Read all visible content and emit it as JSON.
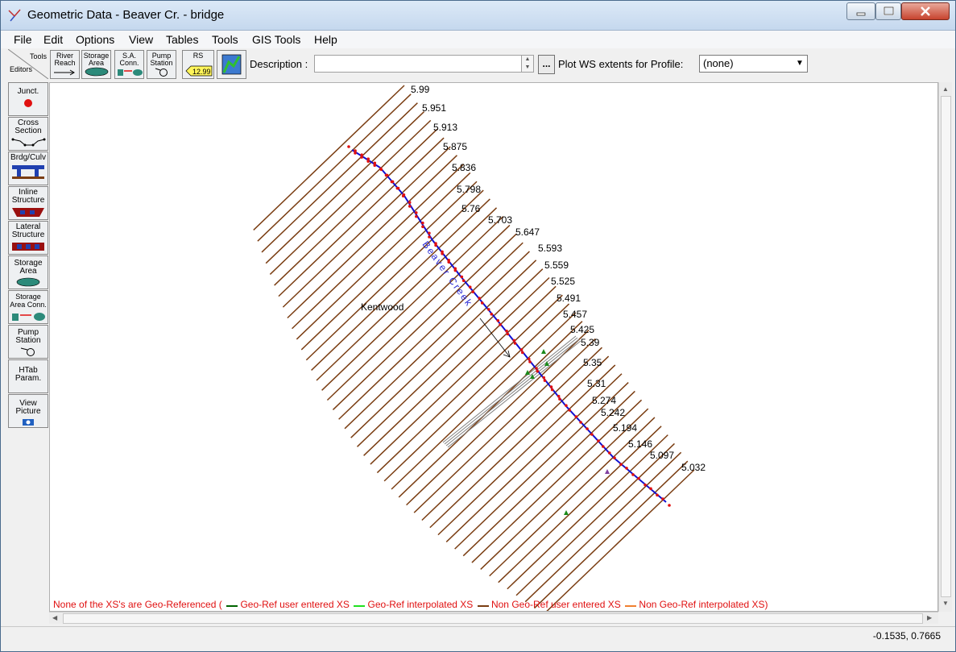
{
  "window": {
    "title": "Geometric Data - Beaver Cr.  - bridge",
    "icon": "hec-ras-geometry-icon"
  },
  "menu": [
    "File",
    "Edit",
    "Options",
    "View",
    "Tables",
    "Tools",
    "GIS Tools",
    "Help"
  ],
  "toolbar": {
    "tools_label": "Tools",
    "editors_label": "Editors",
    "buttons": [
      {
        "label": "River\nReach",
        "icon": "river-reach-icon"
      },
      {
        "label": "Storage\nArea",
        "icon": "storage-area-icon"
      },
      {
        "label": "S.A.\nConn.",
        "icon": "sa-connection-icon"
      },
      {
        "label": "Pump\nStation",
        "icon": "pump-station-icon"
      },
      {
        "label": "RS",
        "value": "12.99",
        "icon": "river-station-tag-icon"
      },
      {
        "label": "",
        "icon": "map-picture-icon"
      }
    ],
    "description_label": "Description :",
    "description_value": "",
    "more_button": "...",
    "plot_ws_label": "Plot WS extents for Profile:",
    "plot_ws_value": "(none)"
  },
  "sidebar": [
    {
      "label": "Junct.",
      "icon": "junction-dot-icon"
    },
    {
      "label": "Cross\nSection",
      "icon": "cross-section-icon"
    },
    {
      "label": "Brdg/Culv",
      "icon": "bridge-culvert-icon"
    },
    {
      "label": "Inline\nStructure",
      "icon": "inline-structure-icon"
    },
    {
      "label": "Lateral\nStructure",
      "icon": "lateral-structure-icon"
    },
    {
      "label": "Storage\nArea",
      "icon": "storage-area-icon"
    },
    {
      "label": "Storage\nArea Conn.",
      "icon": "storage-area-conn-icon"
    },
    {
      "label": "Pump\nStation",
      "icon": "pump-station-icon"
    },
    {
      "label": "HTab\nParam.",
      "icon": ""
    },
    {
      "label": "View\nPicture",
      "icon": "camera-icon"
    }
  ],
  "map": {
    "river_name": "Beaver Creek",
    "area_label": "Kentwood",
    "station_labels": [
      "5.99",
      "5.951",
      "5.913",
      "5.875",
      "5.836",
      "5.798",
      "5.76",
      "5.703",
      "5.647",
      "5.593",
      "5.559",
      "5.525",
      "5.491",
      "5.457",
      "5.425",
      "5.39",
      "5.35",
      "5.31",
      "5.274",
      "5.242",
      "5.194",
      "5.146",
      "5.097",
      "5.032"
    ],
    "colors": {
      "xs_line": "#7a3d12",
      "river": "#1010d0",
      "bank_point": "#e01010",
      "bridge": "#808080",
      "legend_red": "#e01010"
    }
  },
  "legend": {
    "prefix": "None of the XS's are Geo-Referenced (",
    "items": [
      {
        "label": "Geo-Ref user entered XS",
        "color": "#006400"
      },
      {
        "label": "Geo-Ref interpolated XS",
        "color": "#20e020"
      },
      {
        "label": "Non Geo-Ref user entered XS",
        "color": "#7a3d12"
      },
      {
        "label": "Non Geo-Ref interpolated XS)",
        "color": "#f08030"
      }
    ]
  },
  "status": {
    "coordinates": "-0.1535, 0.7665"
  }
}
